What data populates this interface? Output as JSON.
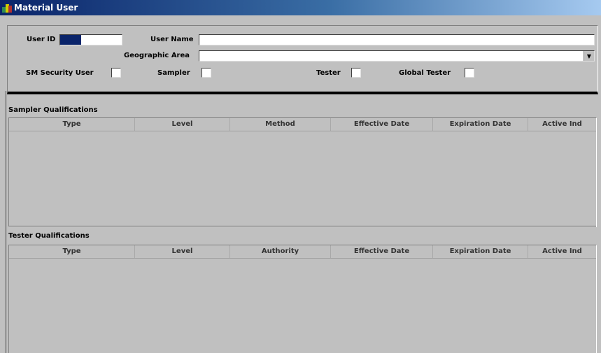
{
  "window": {
    "title": "Material User"
  },
  "header": {
    "user_id_label": "User ID",
    "user_id_value": "",
    "user_name_label": "User Name",
    "user_name_value": "",
    "geo_area_label": "Geographic Area",
    "geo_area_value": "",
    "sm_security_label": "SM Security User",
    "sampler_label": "Sampler",
    "tester_label": "Tester",
    "global_tester_label": "Global Tester",
    "sm_security_checked": false,
    "sampler_checked": false,
    "tester_checked": false,
    "global_tester_checked": false
  },
  "sampler_qualifications": {
    "title": "Sampler Qualifications",
    "columns": [
      "Type",
      "Level",
      "Method",
      "Effective Date",
      "Expiration Date",
      "Active Ind"
    ],
    "rows": []
  },
  "tester_qualifications": {
    "title": "Tester Qualifications",
    "columns": [
      "Type",
      "Level",
      "Authority",
      "Effective Date",
      "Expiration Date",
      "Active Ind"
    ],
    "rows": []
  },
  "colors": {
    "title_bar": "#0a246a",
    "background": "#c0c0c0",
    "selection": "#0a246a"
  }
}
